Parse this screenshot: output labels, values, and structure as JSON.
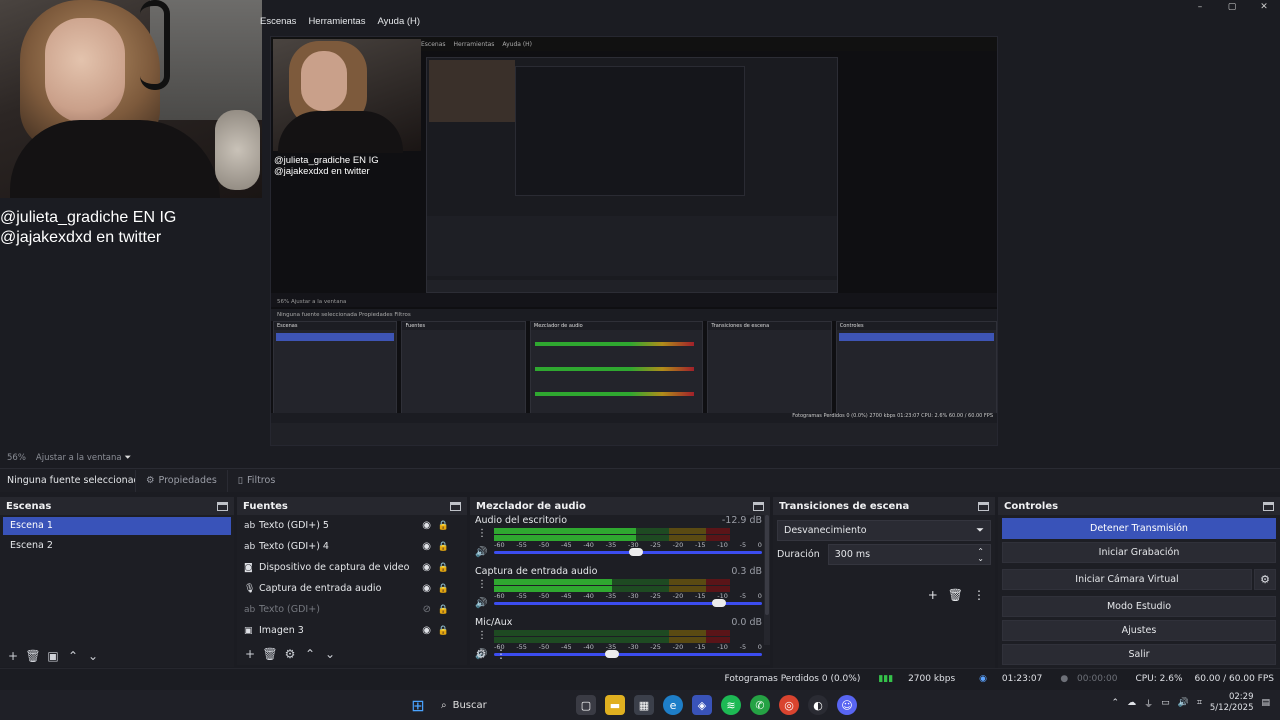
{
  "menu": {
    "items": [
      "Escenas",
      "Herramientas",
      "Ayuda (H)"
    ]
  },
  "window_controls": [
    "–",
    "▢",
    "✕"
  ],
  "overlay": {
    "line1": "@julieta_gradiche EN IG",
    "line2": "@jajakexdxd en twitter"
  },
  "preview_inner": {
    "menu": [
      "Escenas",
      "Herramientas",
      "Ayuda (H)"
    ],
    "overlay_line1": "@julieta_gradiche EN IG",
    "overlay_line2": "@jajakexdxd en twitter",
    "strip": "56%  Ajustar a la ventana",
    "props": "Ninguna fuente seleccionada   Propiedades   Filtros",
    "dock_titles": [
      "Escenas",
      "Fuentes",
      "Mezclador de audio",
      "Transiciones de escena",
      "Controles"
    ],
    "status": "Fotogramas Perdidos 0 (0.0%)   2700 kbps   01:23:07   CPU: 2.6%   60.00 / 60.00 FPS"
  },
  "scale": {
    "zoom": "56%",
    "fit": "Ajustar a la ventana"
  },
  "props_bar": {
    "no_source": "Ninguna fuente seleccionada",
    "properties": "Propiedades",
    "filters": "Filtros"
  },
  "scenes": {
    "title": "Escenas",
    "items": [
      {
        "label": "Escena 1",
        "active": true
      },
      {
        "label": "Escena 2",
        "active": false
      }
    ]
  },
  "sources": {
    "title": "Fuentes",
    "items": [
      {
        "label": "Texto (GDI+) 5",
        "icon": "text-icon",
        "visible": true
      },
      {
        "label": "Texto (GDI+) 4",
        "icon": "text-icon",
        "visible": true
      },
      {
        "label": "Dispositivo de captura de video",
        "icon": "camera-icon",
        "visible": true
      },
      {
        "label": "Captura de entrada audio",
        "icon": "microphone-icon",
        "visible": true
      },
      {
        "label": "Texto (GDI+)",
        "icon": "text-icon",
        "visible": false
      },
      {
        "label": "Imagen 3",
        "icon": "image-icon",
        "visible": true
      }
    ]
  },
  "mixer": {
    "title": "Mezclador de audio",
    "ticks": [
      "-60",
      "-55",
      "-50",
      "-45",
      "-40",
      "-35",
      "-30",
      "-25",
      "-20",
      "-15",
      "-10",
      "-5",
      "0"
    ],
    "channels": [
      {
        "name": "Audio del escritorio",
        "db": "-12.9 dB",
        "level": 0.6,
        "volume": 0.61
      },
      {
        "name": "Captura de entrada audio",
        "db": "0.3 dB",
        "level": 0.5,
        "volume": 0.98
      },
      {
        "name": "Mic/Aux",
        "db": "0.0 dB",
        "level": 0.0,
        "volume": 0.5
      }
    ]
  },
  "transitions": {
    "title": "Transiciones de escena",
    "selected": "Desvanecimiento",
    "duration_label": "Duración",
    "duration_value": "300 ms"
  },
  "controls": {
    "title": "Controles",
    "stop_stream": "Detener Transmisión",
    "start_recording": "Iniciar Grabación",
    "start_virtual_cam": "Iniciar Cámara Virtual",
    "studio_mode": "Modo Estudio",
    "settings": "Ajustes",
    "exit": "Salir"
  },
  "status": {
    "dropped_frames": "Fotogramas Perdidos 0 (0.0%)",
    "bitrate": "2700 kbps",
    "stream_time": "01:23:07",
    "rec_time": "00:00:00",
    "cpu": "CPU: 2.6%",
    "fps": "60.00 / 60.00 FPS"
  },
  "taskbar": {
    "search": "Buscar",
    "time": "02:29",
    "date": "5/12/2025"
  },
  "colors": {
    "accent": "#3953b9",
    "meter_green": "#2fa830",
    "meter_yellow": "#b08d1a",
    "meter_red": "#a1202a"
  }
}
